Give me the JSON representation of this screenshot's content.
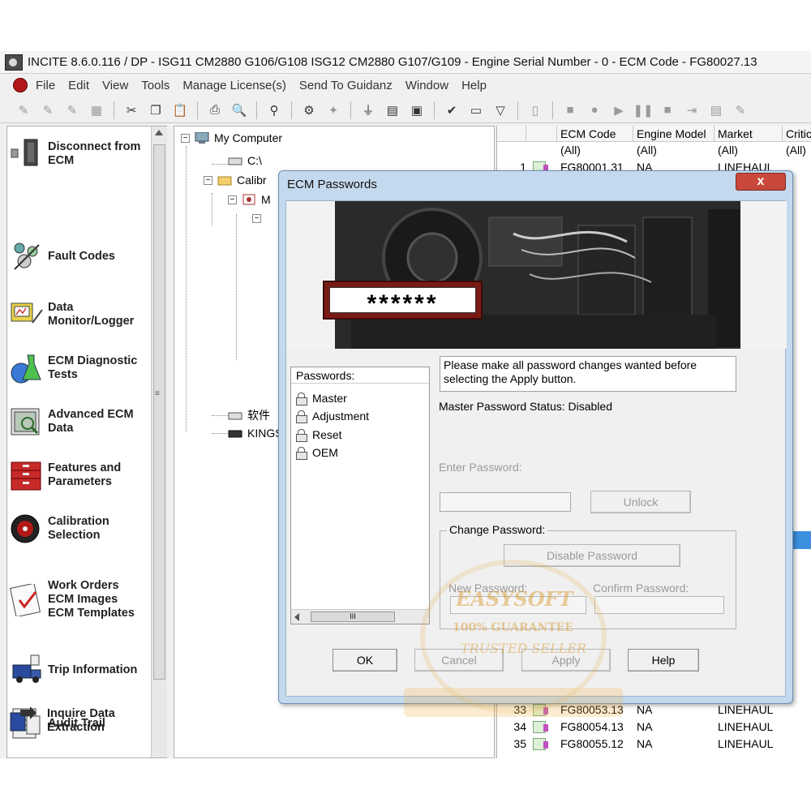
{
  "window": {
    "title": "INCITE 8.6.0.116  / DP - ISG11 CM2880 G106/G108 ISG12 CM2880 G107/G109 - Engine Serial Number - 0 - ECM Code - FG80027.13"
  },
  "menu": {
    "items": [
      "File",
      "Edit",
      "View",
      "Tools",
      "Manage License(s)",
      "Send To Guidanz",
      "Window",
      "Help"
    ]
  },
  "sidebar": {
    "items": [
      {
        "label_line1": "Disconnect from",
        "label_line2": "ECM",
        "icon": "plug-icon"
      },
      {
        "label_line1": "Fault Codes",
        "label_line2": "",
        "icon": "fault-codes-icon"
      },
      {
        "label_line1": "Data",
        "label_line2": "Monitor/Logger",
        "icon": "monitor-icon"
      },
      {
        "label_line1": "ECM Diagnostic",
        "label_line2": "Tests",
        "icon": "flask-icon"
      },
      {
        "label_line1": "Advanced ECM",
        "label_line2": "Data",
        "icon": "chart-magnifier-icon"
      },
      {
        "label_line1": "Features and",
        "label_line2": "Parameters",
        "icon": "toolbox-icon"
      },
      {
        "label_line1": "Calibration",
        "label_line2": "Selection",
        "icon": "disc-icon"
      },
      {
        "label_line1": "Work Orders",
        "label_line2": "ECM Images",
        "label_line3": "ECM Templates",
        "icon": "clipboard-check-icon"
      },
      {
        "label_line1": "Trip Information",
        "label_line2": "",
        "icon": "truck-icon"
      },
      {
        "label_line1": "Audit Trail",
        "label_line2": "",
        "icon": "document-list-icon"
      },
      {
        "label_line1": "Inquire Data",
        "label_line2": "Extraction",
        "icon": "extract-icon"
      }
    ]
  },
  "tree": {
    "root": "My Computer",
    "c_drive": "C:\\",
    "calib": "Calibr",
    "sub_m": "M",
    "chinese": "软件",
    "kings": "KINGS"
  },
  "grid": {
    "headers": [
      "ECM Code",
      "Engine Model",
      "Market",
      "Critic"
    ],
    "filters": [
      "(All)",
      "(All)",
      "(All)",
      "(All)"
    ],
    "rows_top": [
      {
        "num": "1",
        "code": "FG80001.31",
        "model": "NA",
        "market": "LINEHAUL"
      }
    ],
    "rows_bottom": [
      {
        "num": "33",
        "code": "FG80053.13",
        "model": "NA",
        "market": "LINEHAUL"
      },
      {
        "num": "34",
        "code": "FG80054.13",
        "model": "NA",
        "market": "LINEHAUL"
      },
      {
        "num": "35",
        "code": "FG80055.12",
        "model": "NA",
        "market": "LINEHAUL"
      }
    ]
  },
  "dialog": {
    "title": "ECM Passwords",
    "close_label": "x",
    "banner_password": "******",
    "passwords_header": "Passwords:",
    "password_items": [
      "Master",
      "Adjustment",
      "Reset",
      "OEM"
    ],
    "scroll_grip": "III",
    "info_line1": "Please make all password changes wanted before",
    "info_line2": "selecting the Apply button.",
    "status_label": "Master Password Status:",
    "status_value": "Disabled",
    "enter_password_label": "Enter Password:",
    "enter_password_value": "",
    "unlock_label": "Unlock",
    "change_password_legend": "Change Password:",
    "disable_password_label": "Disable Password",
    "new_password_label": "New Password:",
    "confirm_password_label": "Confirm Password:",
    "ok_label": "OK",
    "cancel_label": "Cancel",
    "apply_label": "Apply",
    "help_label": "Help"
  },
  "watermark": {
    "line1": "EASYSOFT",
    "line2": "100% GUARANTEE",
    "line3": "TRUSTED SELLER"
  }
}
